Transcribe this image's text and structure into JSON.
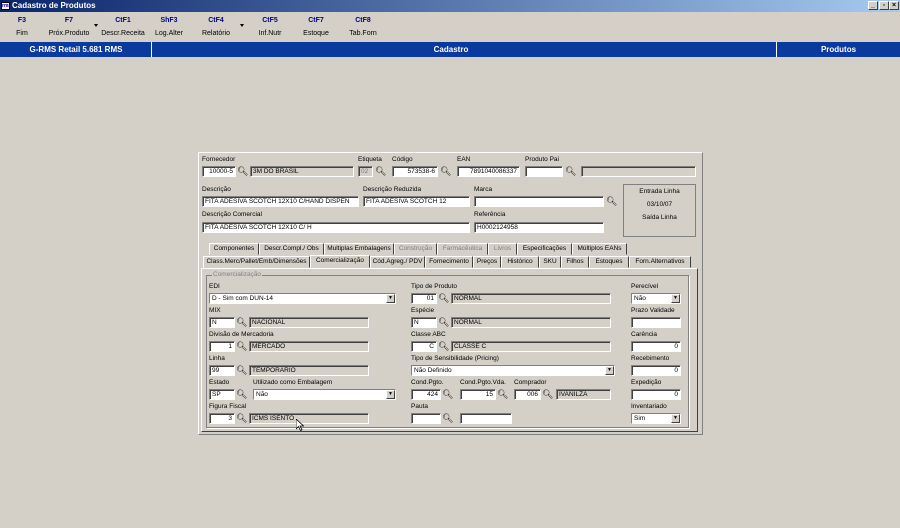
{
  "window": {
    "title": "Cadastro de Produtos",
    "app_icon": "rms"
  },
  "toolbar": [
    {
      "key": "F3",
      "label": "Fim"
    },
    {
      "key": "F7",
      "label": "Próx.Produto"
    },
    {
      "key": "CtF1",
      "label": "Descr.Receita"
    },
    {
      "key": "ShF3",
      "label": "Log.Alter"
    },
    {
      "key": "CtF4",
      "label": "Relatório"
    },
    {
      "key": "CtF5",
      "label": "Inf.Nutr"
    },
    {
      "key": "CtF7",
      "label": "Estoque"
    },
    {
      "key": "CtF8",
      "label": "Tab.Forn"
    }
  ],
  "header": {
    "system": "G-RMS Retail 5.681 RMS",
    "screen": "Cadastro",
    "module": "Produtos"
  },
  "top": {
    "fornecedor_label": "Fornecedor",
    "fornecedor_code": "10000-5",
    "fornecedor_name": "3M DO BRASIL",
    "etiqueta_label": "Etiqueta",
    "etiqueta_value": "02",
    "codigo_label": "Código",
    "codigo_value": "573538-6",
    "ean_label": "EAN",
    "ean_value": "7891040086337",
    "pai_label": "Produto Pai",
    "pai_value": "",
    "descricao_label": "Descrição",
    "descricao_value": "FITA ADESIVA SCOTCH 12X10 C/HAND DISPEN",
    "descred_label": "Descrição Reduzida",
    "descred_value": "FITA ADESIVA SCOTCH 12",
    "marca_label": "Marca",
    "marca_value": "",
    "desccom_label": "Descrição Comercial",
    "desccom_value": "FITA ADESIVA SCOTCH 12X10 C/ H",
    "referencia_label": "Referência",
    "referencia_value": "H0002124958"
  },
  "dates": {
    "entrada_label": "Entrada Linha",
    "entrada_value": "03/10/07",
    "saida_label": "Saída Linha",
    "saida_value": ""
  },
  "tabs_row1": [
    "Componentes",
    "Descr.Compl./ Obs",
    "Multiplas Embalagens",
    "Construção",
    "Farmacêutica",
    "Livros",
    "Especificações",
    "Múltiplos EANs"
  ],
  "tabs_row2": [
    "Class.Merc/Pallet/Emb/Dimensões",
    "Comercialização",
    "Cód.Agreg./ PDV",
    "Fornecimento",
    "Preços",
    "Histórico",
    "SKU",
    "Filhos",
    "Estoques",
    "Forn.Alternativos"
  ],
  "comercializacao": {
    "group_title": "Comercialização",
    "edi_label": "EDI",
    "edi_value": "D - Sim com DUN-14",
    "mix_label": "MIX",
    "mix_code": "N",
    "mix_name": "NACIONAL",
    "divisao_label": "Divisão de Mercadoria",
    "divisao_code": "1",
    "divisao_name": "MERCADO",
    "linha_label": "Linha",
    "linha_code": "99",
    "linha_name": "TEMPORARIO",
    "estado_label": "Estado",
    "estado_value": "SP",
    "embalagem_label": "Utilizado como Embalagem",
    "embalagem_value": "Não",
    "fiscal_label": "Figura Fiscal",
    "fiscal_code": "3",
    "fiscal_name": "ICMS ISENTO",
    "tipo_label": "Tipo de Produto",
    "tipo_code": "01",
    "tipo_name": "NORMAL",
    "especie_label": "Espécie",
    "especie_code": "N",
    "especie_name": "NORMAL",
    "abc_label": "Classe ABC",
    "abc_code": "C",
    "abc_name": "CLASSE C",
    "sens_label": "Tipo de Sensibilidade (Pricing)",
    "sens_value": "Não Definido",
    "condpgto_label": "Cond.Pgto.",
    "condpgto_value": "424",
    "condvda_label": "Cond.Pgto.Vda.",
    "condvda_value": "15",
    "comprador_label": "Comprador",
    "comprador_code": "006",
    "comprador_name": "IVANILZA",
    "pauta_label": "Pauta",
    "pauta_code": "",
    "pauta_name": "",
    "perecivel_label": "Perecível",
    "perecivel_value": "Não",
    "validade_label": "Prazo Validade",
    "validade_value": "",
    "carencia_label": "Carência",
    "carencia_value": "0",
    "recebimento_label": "Recebimento",
    "recebimento_value": "0",
    "expedicao_label": "Expedição",
    "expedicao_value": "0",
    "inventariado_label": "Inventariado",
    "inventariado_value": "Sim"
  }
}
